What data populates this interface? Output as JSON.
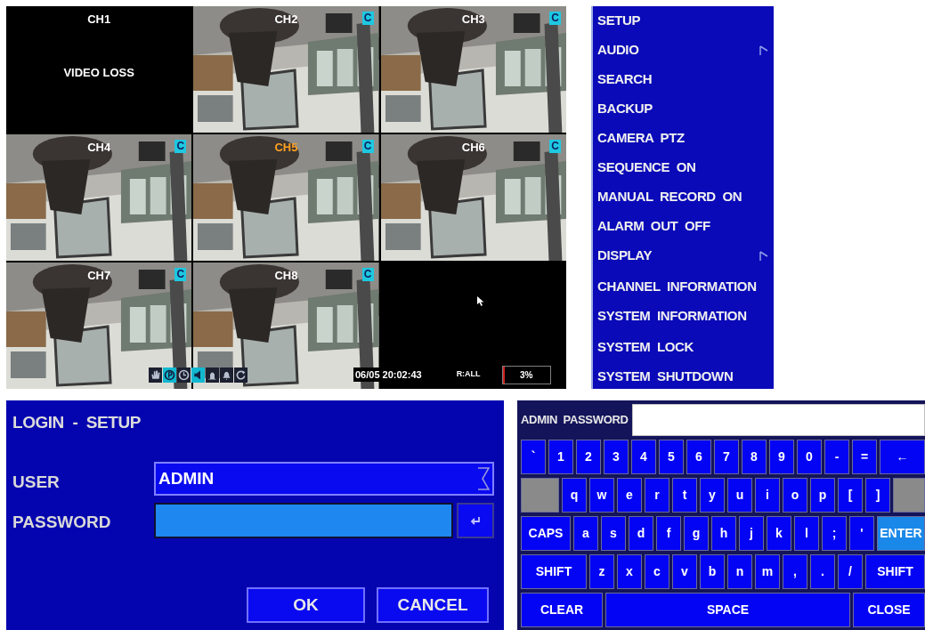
{
  "camera_grid": {
    "tiles": [
      {
        "kind": "loss",
        "channel": "CH1",
        "message": "VIDEO LOSS",
        "selected": false
      },
      {
        "kind": "video",
        "channel": "CH2",
        "badge": "C",
        "selected": false
      },
      {
        "kind": "video",
        "channel": "CH3",
        "badge": "C",
        "selected": false
      },
      {
        "kind": "video",
        "channel": "CH4",
        "badge": "C",
        "selected": false
      },
      {
        "kind": "video",
        "channel": "CH5",
        "badge": "C",
        "selected": true
      },
      {
        "kind": "video",
        "channel": "CH6",
        "badge": "C",
        "selected": false
      },
      {
        "kind": "video",
        "channel": "CH7",
        "badge": "C",
        "selected": false
      },
      {
        "kind": "video",
        "channel": "CH8",
        "badge": "C",
        "selected": false
      },
      {
        "kind": "empty",
        "cursor": true
      }
    ],
    "status_bar": {
      "toolbar": [
        {
          "selected": false
        },
        {
          "selected": true
        },
        {
          "selected": false
        },
        {
          "selected": true
        },
        {
          "selected": false
        },
        {
          "selected": false
        },
        {
          "selected": false
        }
      ],
      "datetime": "06/05 20:02:43",
      "record_mode": "R:ALL",
      "disk_usage": {
        "reading": "3%",
        "level": 0.03
      }
    }
  },
  "menu": {
    "groups": [
      [
        {
          "label": "SETUP",
          "submenu": false
        },
        {
          "label": "AUDIO",
          "submenu": true
        },
        {
          "label": "SEARCH",
          "submenu": false
        },
        {
          "label": "BACKUP",
          "submenu": false
        },
        {
          "label": "CAMERA  PTZ",
          "submenu": false
        },
        {
          "label": "SEQUENCE  ON",
          "submenu": false
        },
        {
          "label": "MANUAL  RECORD  ON",
          "submenu": false
        },
        {
          "label": "ALARM  OUT  OFF",
          "submenu": false
        },
        {
          "label": "DISPLAY",
          "submenu": true
        }
      ],
      [
        {
          "label": "CHANNEL  INFORMATION",
          "submenu": false
        },
        {
          "label": "SYSTEM  INFORMATION",
          "submenu": false
        }
      ],
      [
        {
          "label": "SYSTEM  LOCK",
          "submenu": false
        },
        {
          "label": "SYSTEM  SHUTDOWN",
          "submenu": false
        }
      ]
    ]
  },
  "login": {
    "title": "LOGIN  -  SETUP",
    "user": {
      "label": "USER",
      "value": "ADMIN"
    },
    "password": {
      "label": "PASSWORD",
      "focused": true
    },
    "buttons": [
      "OK",
      "CANCEL"
    ]
  },
  "keyboard": {
    "label": "ADMIN  PASSWORD",
    "key_rows": [
      {
        "keys": [
          {
            "kind": "key",
            "label": "`"
          },
          {
            "kind": "key",
            "label": "1"
          },
          {
            "kind": "key",
            "label": "2"
          },
          {
            "kind": "key",
            "label": "3"
          },
          {
            "kind": "key",
            "label": "4"
          },
          {
            "kind": "key",
            "label": "5"
          },
          {
            "kind": "key",
            "label": "6"
          },
          {
            "kind": "key",
            "label": "7"
          },
          {
            "kind": "key",
            "label": "8"
          },
          {
            "kind": "key",
            "label": "9"
          },
          {
            "kind": "key",
            "label": "0"
          },
          {
            "kind": "key",
            "label": "-"
          },
          {
            "kind": "key",
            "label": "="
          },
          {
            "kind": "fill",
            "label": "←"
          }
        ]
      },
      {
        "keys": [
          {
            "kind": "blank"
          },
          {
            "kind": "key",
            "label": "q"
          },
          {
            "kind": "key",
            "label": "w"
          },
          {
            "kind": "key",
            "label": "e"
          },
          {
            "kind": "key",
            "label": "r"
          },
          {
            "kind": "key",
            "label": "t"
          },
          {
            "kind": "key",
            "label": "y"
          },
          {
            "kind": "key",
            "label": "u"
          },
          {
            "kind": "key",
            "label": "i"
          },
          {
            "kind": "key",
            "label": "o"
          },
          {
            "kind": "key",
            "label": "p"
          },
          {
            "kind": "key",
            "label": "["
          },
          {
            "kind": "key",
            "label": "]"
          },
          {
            "kind": "blank_fill"
          }
        ]
      },
      {
        "keys": [
          {
            "kind": "caps",
            "label": "CAPS"
          },
          {
            "kind": "key",
            "label": "a"
          },
          {
            "kind": "key",
            "label": "s"
          },
          {
            "kind": "key",
            "label": "d"
          },
          {
            "kind": "key",
            "label": "f"
          },
          {
            "kind": "key",
            "label": "g"
          },
          {
            "kind": "key",
            "label": "h"
          },
          {
            "kind": "key",
            "label": "j"
          },
          {
            "kind": "key",
            "label": "k"
          },
          {
            "kind": "key",
            "label": "l"
          },
          {
            "kind": "key",
            "label": ";"
          },
          {
            "kind": "key",
            "label": "'"
          },
          {
            "kind": "enter",
            "label": "ENTER"
          }
        ]
      },
      {
        "keys": [
          {
            "kind": "shift",
            "label": "SHIFT"
          },
          {
            "kind": "key",
            "label": "z"
          },
          {
            "kind": "key",
            "label": "x"
          },
          {
            "kind": "key",
            "label": "c"
          },
          {
            "kind": "key",
            "label": "v"
          },
          {
            "kind": "key",
            "label": "b"
          },
          {
            "kind": "key",
            "label": "n"
          },
          {
            "kind": "key",
            "label": "m"
          },
          {
            "kind": "key",
            "label": ","
          },
          {
            "kind": "key",
            "label": "."
          },
          {
            "kind": "key",
            "label": "/"
          },
          {
            "kind": "fill",
            "label": "SHIFT"
          }
        ]
      },
      {
        "keys": [
          {
            "kind": "clear",
            "label": "CLEAR"
          },
          {
            "kind": "space",
            "label": "SPACE"
          },
          {
            "kind": "fill",
            "label": "CLOSE"
          }
        ]
      }
    ]
  }
}
